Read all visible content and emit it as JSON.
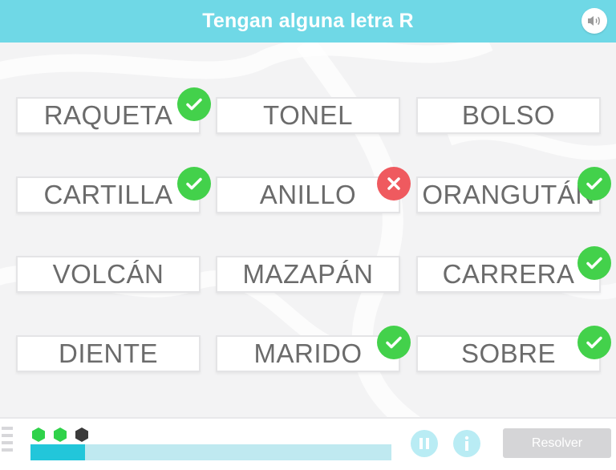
{
  "header": {
    "title": "Tengan alguna letra R",
    "sound_icon": "speaker-icon",
    "color": "#6fd8e6"
  },
  "cards": [
    {
      "word": "RAQUETA",
      "status": "correct"
    },
    {
      "word": "TONEL",
      "status": "none"
    },
    {
      "word": "BOLSO",
      "status": "none"
    },
    {
      "word": "CARTILLA",
      "status": "correct"
    },
    {
      "word": "ANILLO",
      "status": "wrong"
    },
    {
      "word": "ORANGUTÁN",
      "status": "correct"
    },
    {
      "word": "VOLCÁN",
      "status": "none"
    },
    {
      "word": "MAZAPÁN",
      "status": "none"
    },
    {
      "word": "CARRERA",
      "status": "correct"
    },
    {
      "word": "DIENTE",
      "status": "none"
    },
    {
      "word": "MARIDO",
      "status": "correct"
    },
    {
      "word": "SOBRE",
      "status": "correct"
    }
  ],
  "colors": {
    "correct": "#43d14b",
    "wrong": "#ef5a5f",
    "progress_fill": "#22c6da",
    "progress_track": "#bfe9f0",
    "gem_earned": "#2fd24a",
    "gem_pending": "#3a3a3a"
  },
  "footer": {
    "gems": [
      "earned",
      "earned",
      "pending"
    ],
    "progress": 0.15,
    "pause_icon": "pause-icon",
    "info_icon": "info-icon",
    "resolver_label": "Resolver"
  }
}
